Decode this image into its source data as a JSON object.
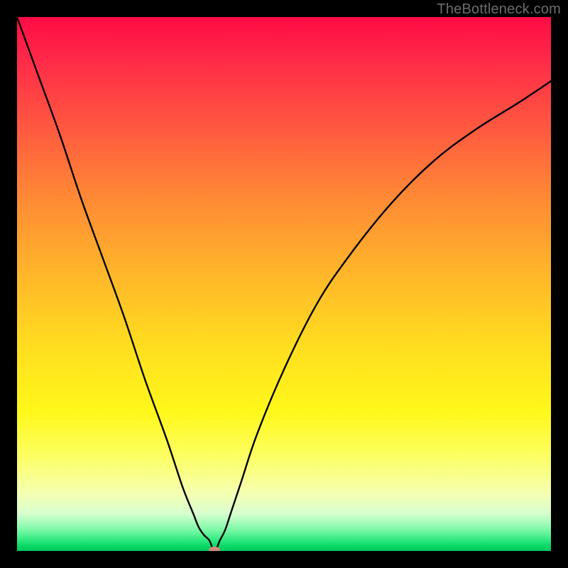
{
  "watermark": {
    "text": "TheBottleneck.com"
  },
  "chart_data": {
    "type": "line",
    "title": "",
    "xlabel": "",
    "ylabel": "",
    "xlim": [
      0,
      100
    ],
    "ylim": [
      0,
      100
    ],
    "grid": false,
    "legend": false,
    "marker": {
      "x": 37,
      "y": 0,
      "color": "#d48a80"
    },
    "gradient_stops": [
      {
        "pos": 0,
        "color": "#ff0b45"
      },
      {
        "pos": 8,
        "color": "#ff2a48"
      },
      {
        "pos": 20,
        "color": "#ff5640"
      },
      {
        "pos": 34,
        "color": "#ff8a35"
      },
      {
        "pos": 48,
        "color": "#ffb62a"
      },
      {
        "pos": 62,
        "color": "#ffde1f"
      },
      {
        "pos": 74,
        "color": "#fff81a"
      },
      {
        "pos": 82,
        "color": "#fdff60"
      },
      {
        "pos": 89,
        "color": "#f6ffb0"
      },
      {
        "pos": 93,
        "color": "#d8ffd0"
      },
      {
        "pos": 96,
        "color": "#7cf9a8"
      },
      {
        "pos": 98,
        "color": "#2ee97e"
      },
      {
        "pos": 99,
        "color": "#0cd968"
      },
      {
        "pos": 100,
        "color": "#00c85b"
      }
    ],
    "series": [
      {
        "name": "bottleneck-curve",
        "color": "#000000",
        "x": [
          0,
          4,
          8,
          12,
          16,
          20,
          24,
          28,
          31,
          33,
          34,
          35,
          36,
          37,
          38,
          39,
          40,
          42,
          45,
          50,
          56,
          62,
          70,
          78,
          86,
          94,
          100
        ],
        "y": [
          100,
          89,
          78,
          66,
          55,
          44,
          32,
          21,
          12,
          7,
          4.5,
          3,
          2,
          0,
          2,
          4,
          7,
          13,
          22,
          34,
          46,
          55,
          65,
          73,
          79,
          84,
          88
        ]
      }
    ]
  }
}
